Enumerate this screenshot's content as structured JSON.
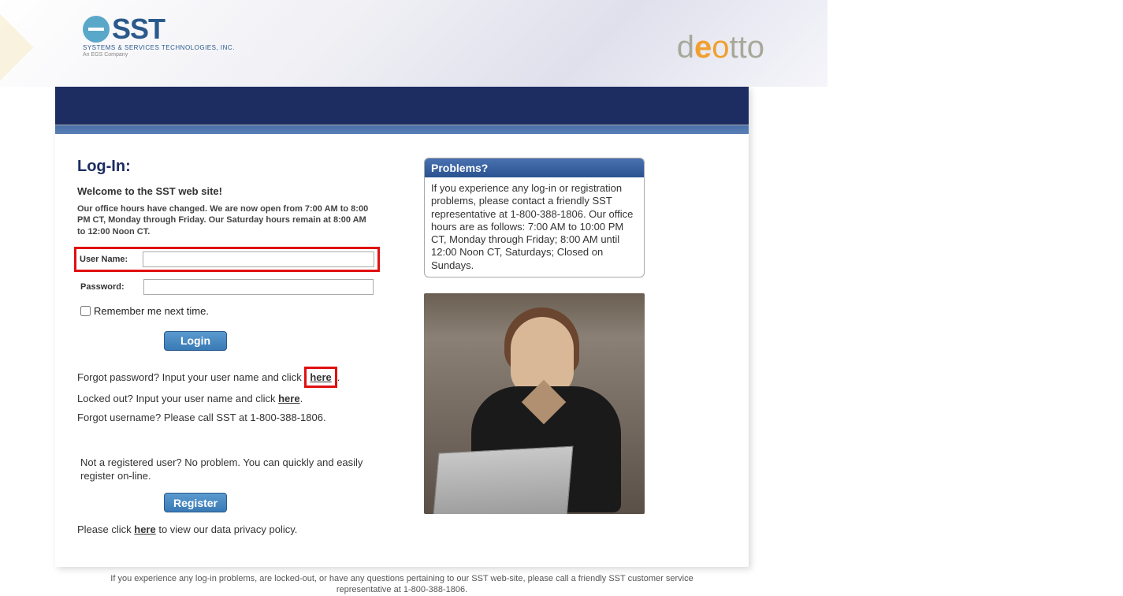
{
  "logo": {
    "brand": "SST",
    "sub1": "SYSTEMS & SERVICES TECHNOLOGIES, INC.",
    "sub2": "An EGS Company"
  },
  "partner": {
    "part1": "d",
    "part2": "e",
    "part3": "o",
    "part4": "tto"
  },
  "login": {
    "title": "Log-In:",
    "welcome": "Welcome to the SST web site!",
    "office_hours": "Our office hours have changed. We are now open from 7:00 AM to 8:00 PM CT, Monday through Friday. Our Saturday hours remain at 8:00 AM to 12:00 Noon CT.",
    "username_label": "User Name:",
    "password_label": "Password:",
    "remember_label": "Remember me next time.",
    "login_button": "Login",
    "forgot_password_pre": "Forgot password? Input your user name and click ",
    "forgot_password_link": "here",
    "forgot_password_post": ".",
    "locked_pre": "Locked out? Input your user name and click ",
    "locked_link": "here",
    "locked_post": ".",
    "forgot_username": "Forgot username? Please call SST at 1-800-388-1806.",
    "not_registered": "Not a registered user? No problem. You can quickly and easily register on-line.",
    "register_button": "Register",
    "privacy_pre": "Please click ",
    "privacy_link": "here",
    "privacy_post": " to view our data privacy policy."
  },
  "problems": {
    "header": "Problems?",
    "body": "If you experience any log-in or registration problems, please contact a friendly SST representative at 1-800-388-1806. Our office hours are as follows: 7:00 AM to 10:00 PM CT, Monday through Friday; 8:00 AM until 12:00 Noon CT, Saturdays; Closed on Sundays."
  },
  "footer": "If you experience any log-in problems, are locked-out, or have any questions pertaining to our SST web-site, please call a friendly SST customer service representative at 1-800-388-1806."
}
